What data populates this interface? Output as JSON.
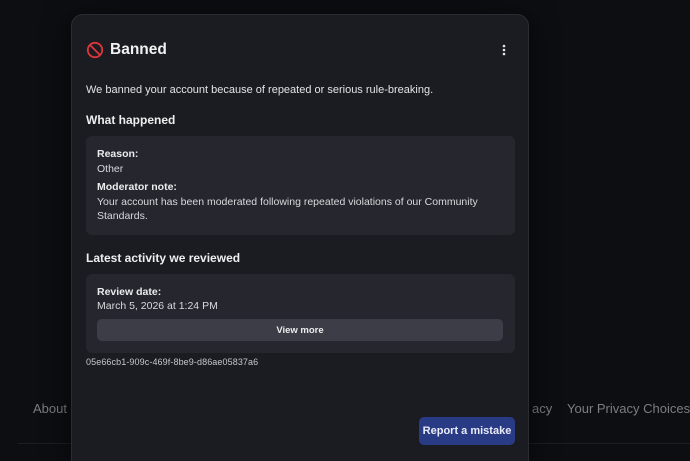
{
  "footer": {
    "about_text": "About U",
    "privacy_text": "acy",
    "choices_text": "Your Privacy Choices",
    "choices_icon": "privacy-choices-icon"
  },
  "modal": {
    "title": "Banned",
    "title_icon": "ban-icon",
    "menu_icon": "more-vertical-icon",
    "intro": "We banned your account because of repeated or serious rule-breaking.",
    "what_happened": {
      "heading": "What happened",
      "reason_label": "Reason:",
      "reason_value": "Other",
      "note_label": "Moderator note:",
      "note_value": "Your account has been moderated following repeated violations of our Community Standards."
    },
    "activity": {
      "heading": "Latest activity we reviewed",
      "date_label": "Review date:",
      "date_value": "March 5, 2026 at 1:24 PM",
      "view_more_label": "View more"
    },
    "reference_id": "05e66cb1-909c-469f-8be9-d86ae05837a6",
    "report_button_label": "Report a mistake"
  },
  "colors": {
    "background": "#0d0e12",
    "modal": "#1b1c21",
    "card": "#26272e",
    "primary_button": "#2a3b86",
    "ban_icon": "#e0353b"
  }
}
